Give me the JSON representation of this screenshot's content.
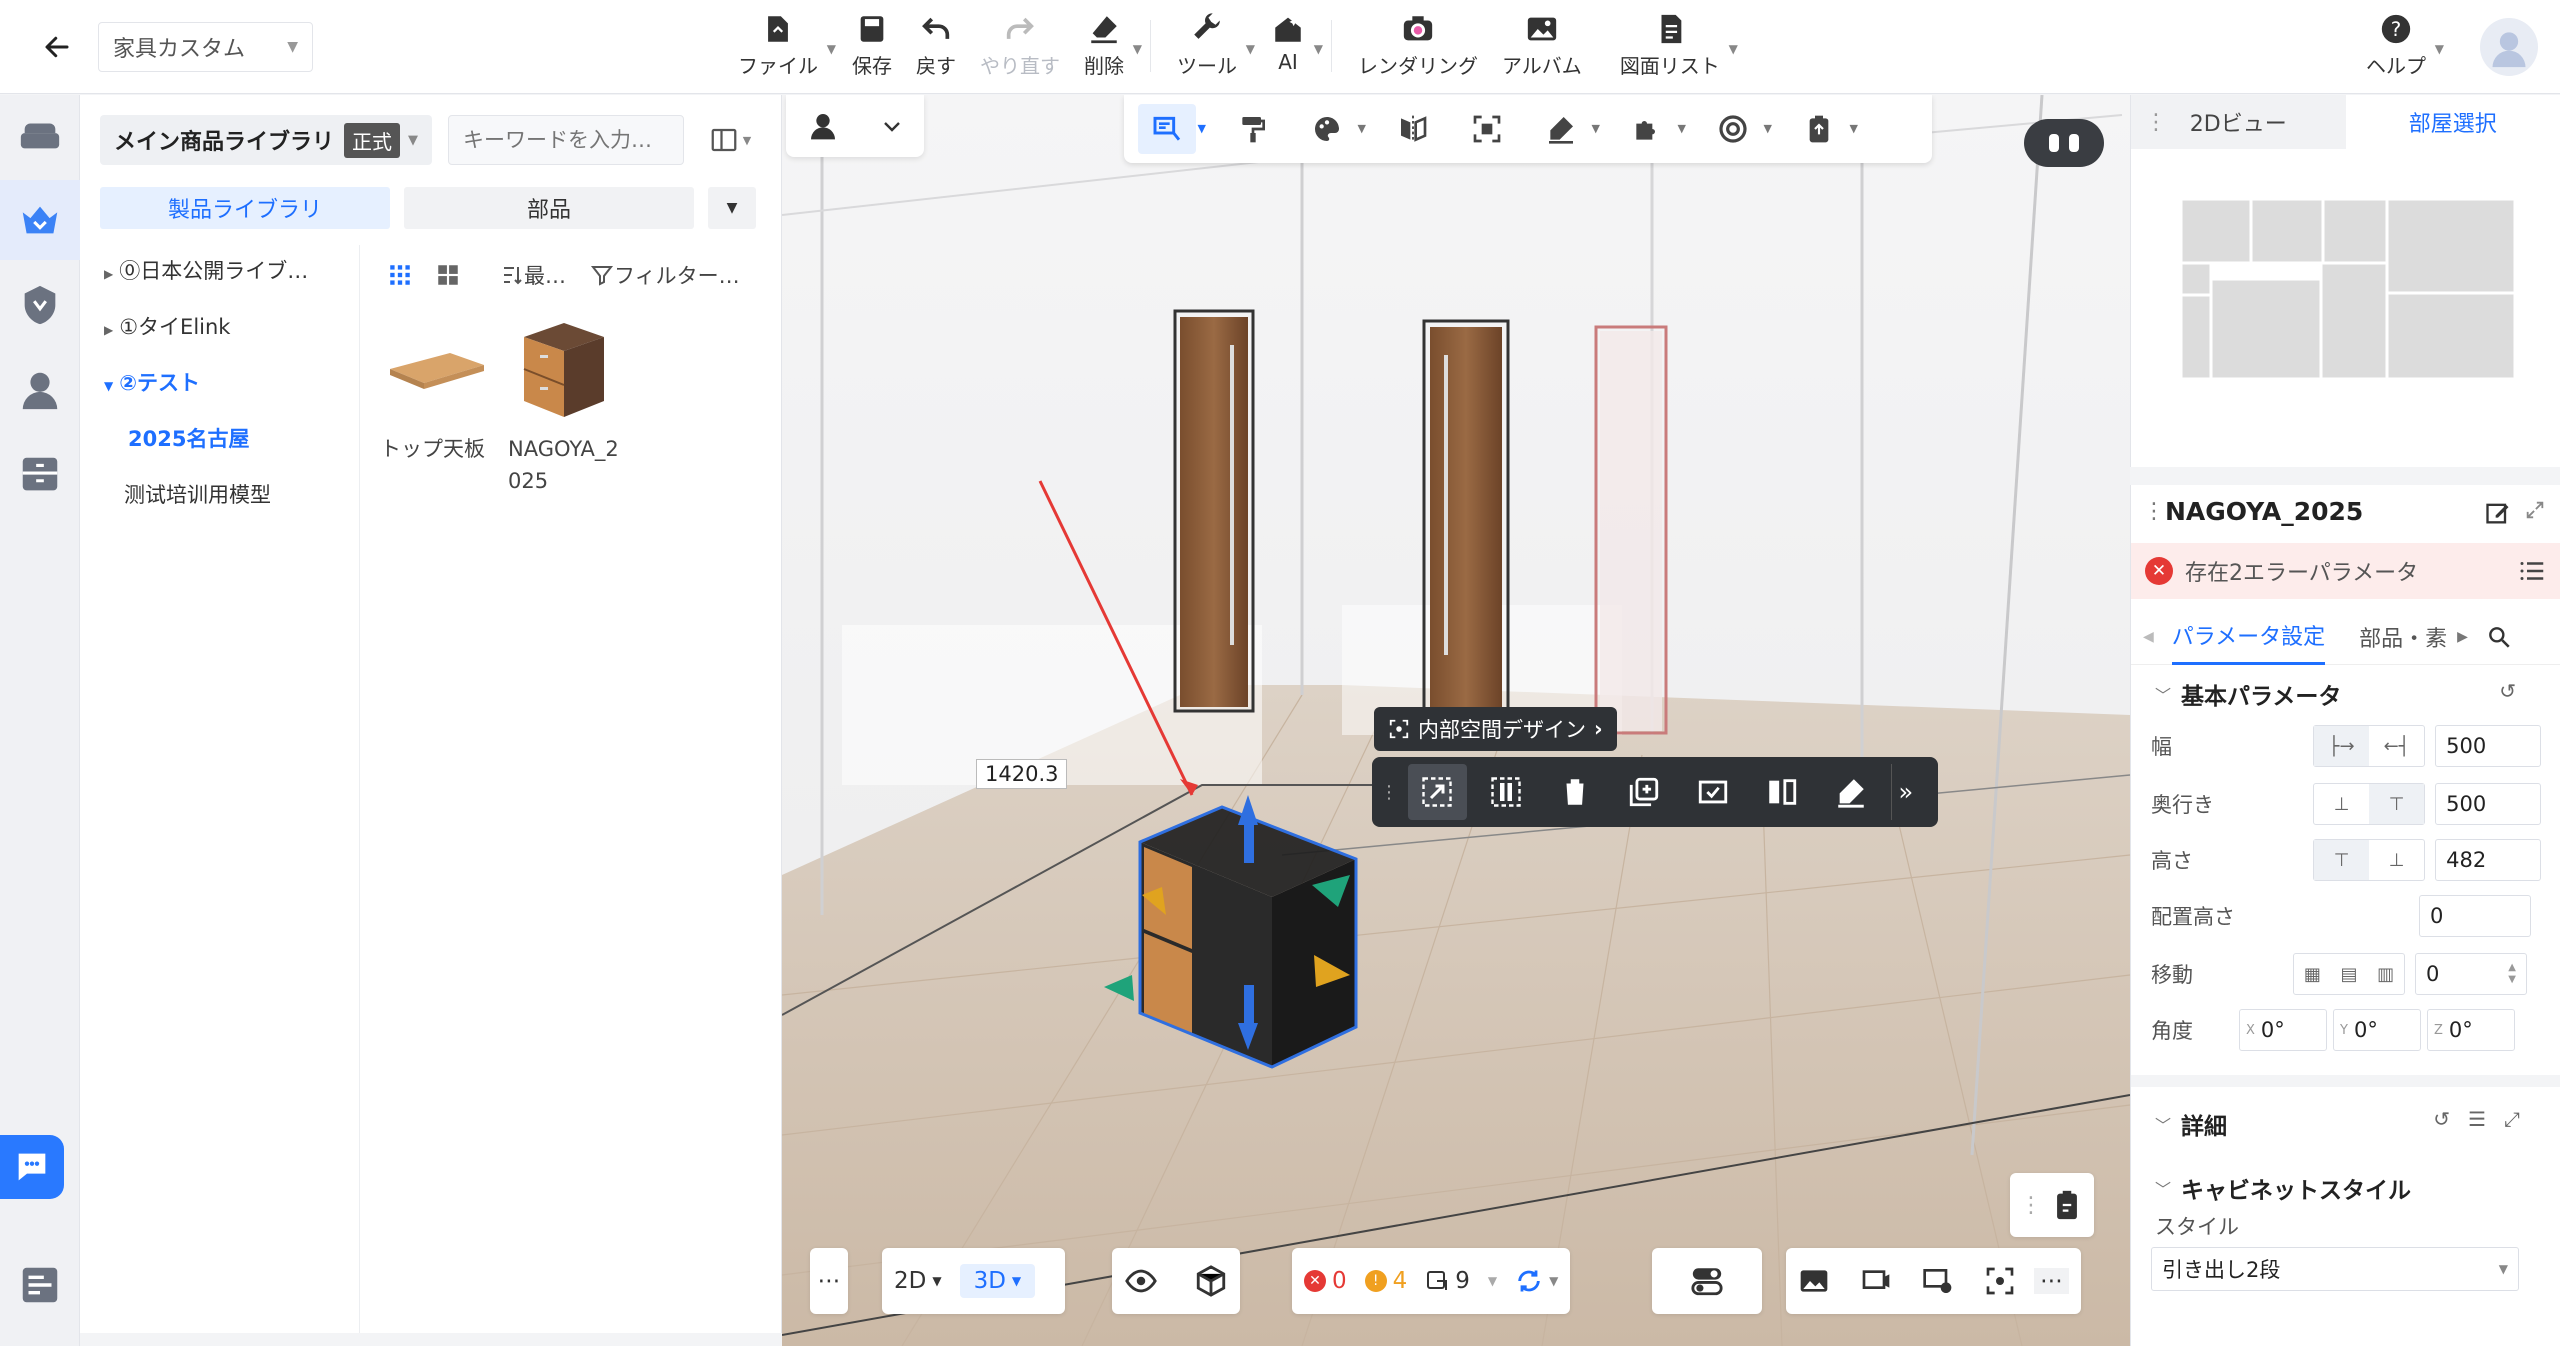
{
  "topbar": {
    "project_name": "家具カスタム",
    "tools": [
      {
        "label": "ファイル",
        "icon": "file-icon"
      },
      {
        "label": "保存",
        "icon": "save-icon"
      },
      {
        "label": "戻す",
        "icon": "undo-icon"
      },
      {
        "label": "やり直す",
        "icon": "redo-icon"
      },
      {
        "label": "削除",
        "icon": "eraser-icon"
      },
      {
        "label": "ツール",
        "icon": "wrench-icon"
      },
      {
        "label": "AI",
        "icon": "ai-house-icon"
      },
      {
        "label": "レンダリング",
        "icon": "camera-icon"
      },
      {
        "label": "アルバム",
        "icon": "album-icon"
      },
      {
        "label": "図面リスト",
        "icon": "drawing-list-icon"
      }
    ],
    "help_label": "ヘルプ"
  },
  "library": {
    "title": "メイン商品ライブラリ",
    "badge": "正式",
    "search_placeholder": "キーワードを入力…",
    "tabs": [
      "製品ライブラリ",
      "部品"
    ],
    "tree": [
      {
        "label": "⓪日本公開ライブ…",
        "state": "collapsed"
      },
      {
        "label": "①タイElink",
        "state": "collapsed"
      },
      {
        "label": "②テスト",
        "state": "expanded"
      },
      {
        "label": "2025名古屋",
        "state": "selected"
      },
      {
        "label": "测试培训用模型",
        "state": "leaf"
      }
    ],
    "sort_label": "最…",
    "filter_label": "フィルター…",
    "products": [
      {
        "name": "トップ天板"
      },
      {
        "name": "NAGOYA_2\n025"
      }
    ]
  },
  "viewport": {
    "dimension_label": "1420.3",
    "context_chip": "内部空間デザイン",
    "view_modes": [
      "2D",
      "3D"
    ],
    "active_view": "3D",
    "status": {
      "errors": "0",
      "warnings": "4",
      "items": "9"
    }
  },
  "minimap": {
    "tabs": [
      "2Dビュー",
      "部屋選択"
    ],
    "active_tab": "部屋選択"
  },
  "properties": {
    "title": "NAGOYA_2025",
    "error_text": "存在2エラーパラメータ",
    "tabs": [
      "パラメータ設定",
      "部品・素"
    ],
    "basic_section": "基本パラメータ",
    "rows": {
      "width": {
        "label": "幅",
        "value": "500"
      },
      "depth": {
        "label": "奥行き",
        "value": "500"
      },
      "height": {
        "label": "高さ",
        "value": "482"
      },
      "elevation": {
        "label": "配置高さ",
        "value": "0"
      },
      "move": {
        "label": "移動",
        "value": "0"
      },
      "angle": {
        "label": "角度",
        "x": "0°",
        "y": "0°",
        "z": "0°"
      }
    },
    "detail_section": "詳細",
    "cabinet_section": "キャビネットスタイル",
    "style_label": "スタイル",
    "style_value": "引き出し2段"
  }
}
